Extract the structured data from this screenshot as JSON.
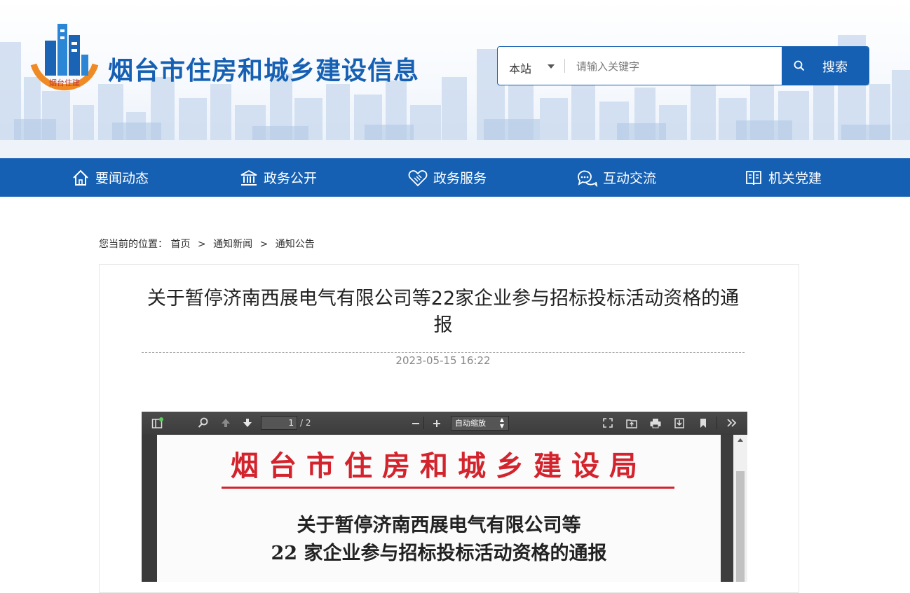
{
  "header": {
    "site_title": "烟台市住房和城乡建设信息",
    "logo_text": "烟台住建",
    "search": {
      "scope_label": "本站",
      "placeholder": "请输入关键字",
      "button_label": "搜索"
    }
  },
  "nav": {
    "items": [
      {
        "label": "要闻动态",
        "icon": "home-icon"
      },
      {
        "label": "政务公开",
        "icon": "government-building-icon"
      },
      {
        "label": "政务服务",
        "icon": "handshake-icon"
      },
      {
        "label": "互动交流",
        "icon": "chat-bubbles-icon"
      },
      {
        "label": "机关党建",
        "icon": "book-icon"
      }
    ]
  },
  "breadcrumb": {
    "prefix": "您当前的位置：",
    "items": [
      "首页",
      "通知新闻",
      "通知公告"
    ],
    "separator": ">"
  },
  "article": {
    "title": "关于暂停济南西展电气有限公司等22家企业参与招标投标活动资格的通报",
    "date": "2023-05-15 16:22"
  },
  "pdf_viewer": {
    "current_page": "1",
    "total_pages": "/ 2",
    "zoom_label": "自动缩放",
    "document": {
      "organization": "烟台市住房和城乡建设局",
      "title_line1": "关于暂停济南西展电气有限公司等",
      "title_line2": "22 家企业参与招标投标活动资格的通报"
    }
  },
  "colors": {
    "brand_blue": "#1660b3",
    "document_red": "#d3232c"
  }
}
